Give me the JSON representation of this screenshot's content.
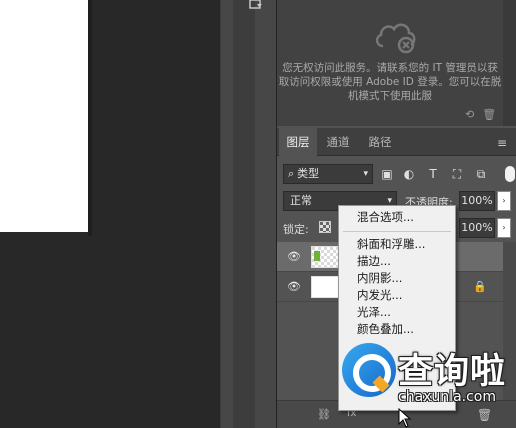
{
  "canvas": {
    "document_color": "#ffffff",
    "background": "#282828"
  },
  "creative_cloud": {
    "icon": "cloud-offline-icon",
    "message": "您无权访问此服务。请联系您的 IT 管理员以获取访问权限或使用 Adobe ID 登录。您可以在脱机模式下使用此服",
    "footer_icons": [
      "sync-icon",
      "trash-icon"
    ]
  },
  "layers_panel": {
    "tabs": [
      {
        "label": "图层",
        "active": true
      },
      {
        "label": "通道",
        "active": false
      },
      {
        "label": "路径",
        "active": false
      }
    ],
    "filter": {
      "icon": "search-icon",
      "value": "类型"
    },
    "filter_icons": [
      "image-filter-icon",
      "adjustment-filter-icon",
      "type-filter-icon",
      "shape-filter-icon",
      "smart-object-filter-icon"
    ],
    "blend_mode": "正常",
    "opacity_label": "不透明度:",
    "opacity_value": "100%",
    "lock_label": "锁定:",
    "fill_value": "100%",
    "layers": [
      {
        "visible": true,
        "selected": true,
        "thumbnail": "transparent"
      },
      {
        "visible": true,
        "selected": false,
        "thumbnail": "white",
        "locked": true
      }
    ]
  },
  "context_menu": {
    "items": [
      "混合选项...",
      "斜面和浮雕...",
      "描边...",
      "内阴影...",
      "内发光...",
      "光泽...",
      "颜色叠加..."
    ]
  },
  "watermark": {
    "title": "查询啦",
    "domain": "chaxunla.com",
    "accent": "#1e88e5"
  }
}
